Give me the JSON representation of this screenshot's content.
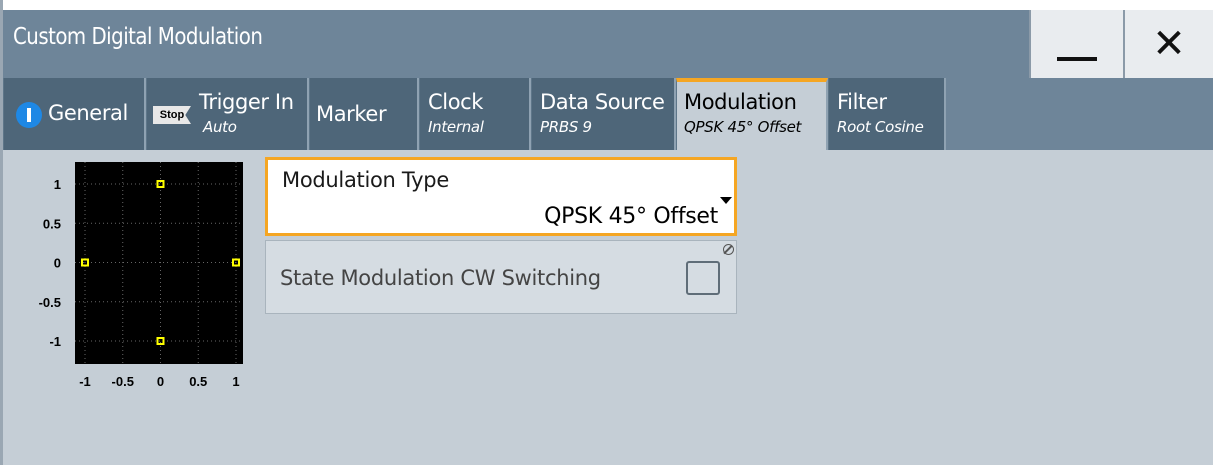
{
  "window": {
    "title": "Custom Digital Modulation",
    "minimize_icon": "minimize-icon",
    "close_icon": "close-icon",
    "close_glyph": "✕"
  },
  "tabs": [
    {
      "label": "General",
      "sub": "",
      "icon": "info-icon"
    },
    {
      "label": "Trigger In",
      "sub": "Auto",
      "badge": "Stop"
    },
    {
      "label": "Marker",
      "sub": ""
    },
    {
      "label": "Clock",
      "sub": "Internal"
    },
    {
      "label": "Data Source",
      "sub": "PRBS 9"
    },
    {
      "label": "Modulation",
      "sub": "QPSK 45° Offset",
      "active": true
    },
    {
      "label": "Filter",
      "sub": "Root Cosine"
    }
  ],
  "constellation": {
    "x_ticks": [
      "-1",
      "-0.5",
      "0",
      "0.5",
      "1"
    ],
    "y_ticks": [
      "1",
      "0.5",
      "0",
      "-0.5",
      "-1"
    ],
    "points": [
      [
        0,
        1
      ],
      [
        -1,
        0
      ],
      [
        1,
        0
      ],
      [
        0,
        -1
      ]
    ],
    "point_color": "#ffff00",
    "background": "#000000"
  },
  "modulation_type": {
    "label": "Modulation Type",
    "value": "QPSK 45° Offset"
  },
  "cw_switching": {
    "label": "State Modulation CW Switching",
    "checked": false
  },
  "colors": {
    "accent": "#f5a623",
    "tab_bg": "#4e6679",
    "title_bg": "#6e8599",
    "panel_bg": "#c5ced6"
  }
}
